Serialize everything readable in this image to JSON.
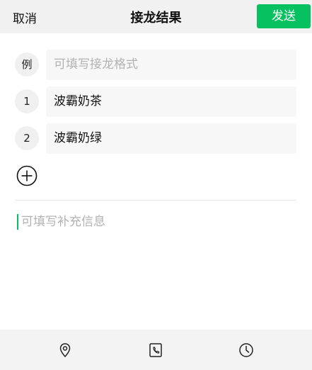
{
  "header": {
    "cancel_label": "取消",
    "title": "接龙结果",
    "send_label": "发送"
  },
  "example_row": {
    "badge": "例",
    "placeholder": "可填写接龙格式"
  },
  "entries": [
    {
      "index": "1",
      "value": "波霸奶茶"
    },
    {
      "index": "2",
      "value": "波霸奶绿"
    }
  ],
  "info": {
    "placeholder": "可填写补充信息"
  },
  "icons": {
    "add": "add-circle-icon",
    "location": "location-pin-icon",
    "phone": "phone-icon",
    "clock": "clock-icon"
  },
  "colors": {
    "accent": "#07c160",
    "header_bg": "#f1f1f1",
    "field_bg": "#f7f7f7",
    "placeholder": "#b2b2b2"
  }
}
